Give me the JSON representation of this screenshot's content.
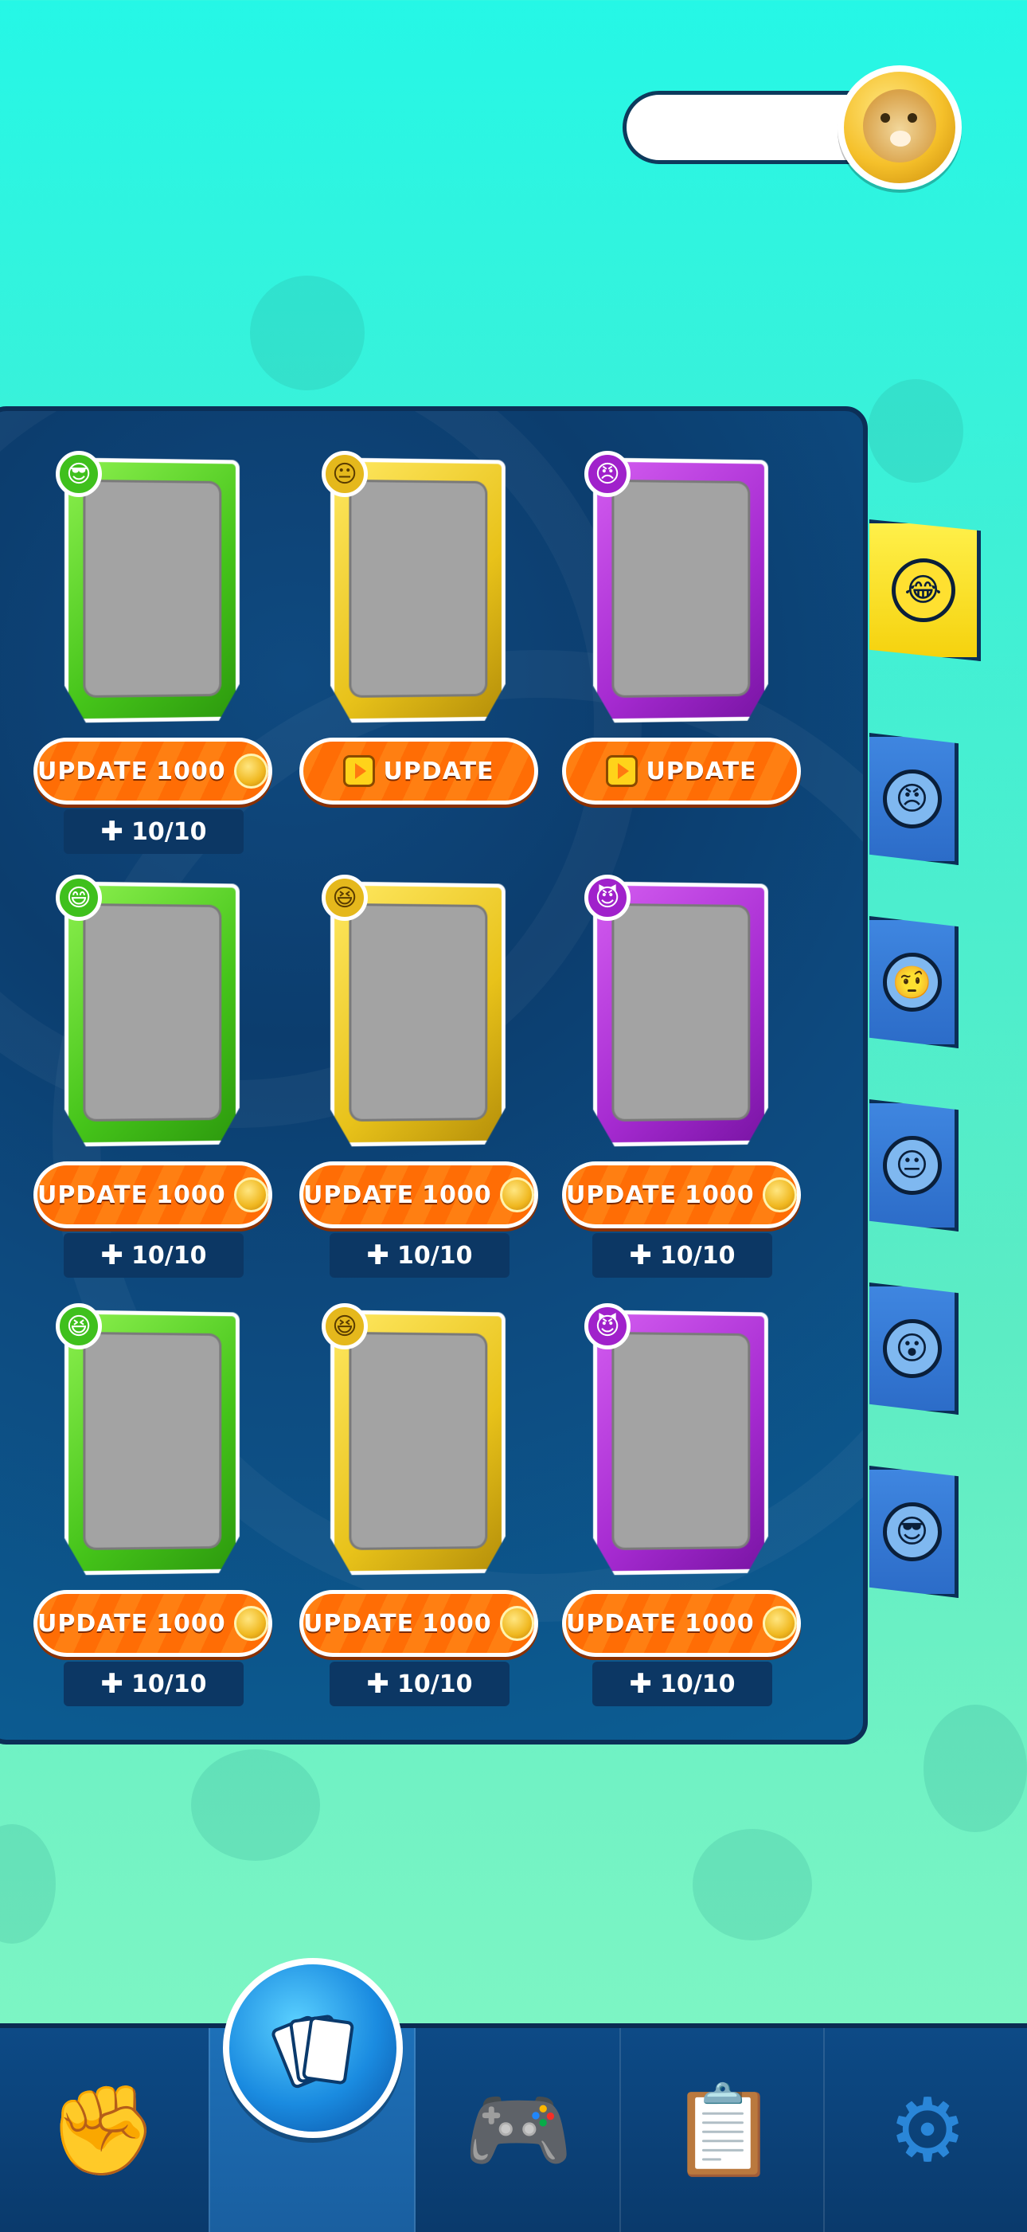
{
  "header": {
    "coin_balance": ""
  },
  "cards": [
    {
      "rarity": "green",
      "badge": "😎",
      "button": {
        "label": "UPDATE",
        "cost": "1000",
        "type": "coin"
      },
      "pieces": "10/10"
    },
    {
      "rarity": "yellow",
      "badge": "😐",
      "button": {
        "label": "UPDATE",
        "cost": "",
        "type": "video"
      },
      "pieces": ""
    },
    {
      "rarity": "purple",
      "badge": "😠",
      "button": {
        "label": "UPDATE",
        "cost": "",
        "type": "video"
      },
      "pieces": ""
    },
    {
      "rarity": "green",
      "badge": "😄",
      "button": {
        "label": "UPDATE",
        "cost": "1000",
        "type": "coin"
      },
      "pieces": "10/10"
    },
    {
      "rarity": "yellow",
      "badge": "😆",
      "button": {
        "label": "UPDATE",
        "cost": "1000",
        "type": "coin"
      },
      "pieces": "10/10"
    },
    {
      "rarity": "purple",
      "badge": "😈",
      "button": {
        "label": "UPDATE",
        "cost": "1000",
        "type": "coin"
      },
      "pieces": "10/10"
    },
    {
      "rarity": "green",
      "badge": "😆",
      "button": {
        "label": "UPDATE",
        "cost": "1000",
        "type": "coin"
      },
      "pieces": "10/10"
    },
    {
      "rarity": "yellow",
      "badge": "😆",
      "button": {
        "label": "UPDATE",
        "cost": "1000",
        "type": "coin"
      },
      "pieces": "10/10"
    },
    {
      "rarity": "purple",
      "badge": "😈",
      "button": {
        "label": "UPDATE",
        "cost": "1000",
        "type": "coin"
      },
      "pieces": "10/10"
    }
  ],
  "side_tabs": [
    {
      "name": "laughing",
      "glyph": "😂",
      "active": true
    },
    {
      "name": "angry",
      "glyph": "😠",
      "active": false
    },
    {
      "name": "suspicious",
      "glyph": "🤨",
      "active": false
    },
    {
      "name": "neutral",
      "glyph": "😐",
      "active": false
    },
    {
      "name": "surprised",
      "glyph": "😮",
      "active": false
    },
    {
      "name": "cool",
      "glyph": "😎",
      "active": false
    }
  ],
  "nav": [
    {
      "name": "shop",
      "glyph": "✊"
    },
    {
      "name": "cards",
      "glyph": ""
    },
    {
      "name": "play",
      "glyph": "🎮"
    },
    {
      "name": "tasks",
      "glyph": "📋"
    },
    {
      "name": "settings",
      "glyph": "⚙"
    }
  ],
  "colors": {
    "green": "#45c41a",
    "yellow": "#e8c21a",
    "purple": "#a52ad0",
    "button": "#ff7112",
    "panel": "#0c3d6e"
  }
}
